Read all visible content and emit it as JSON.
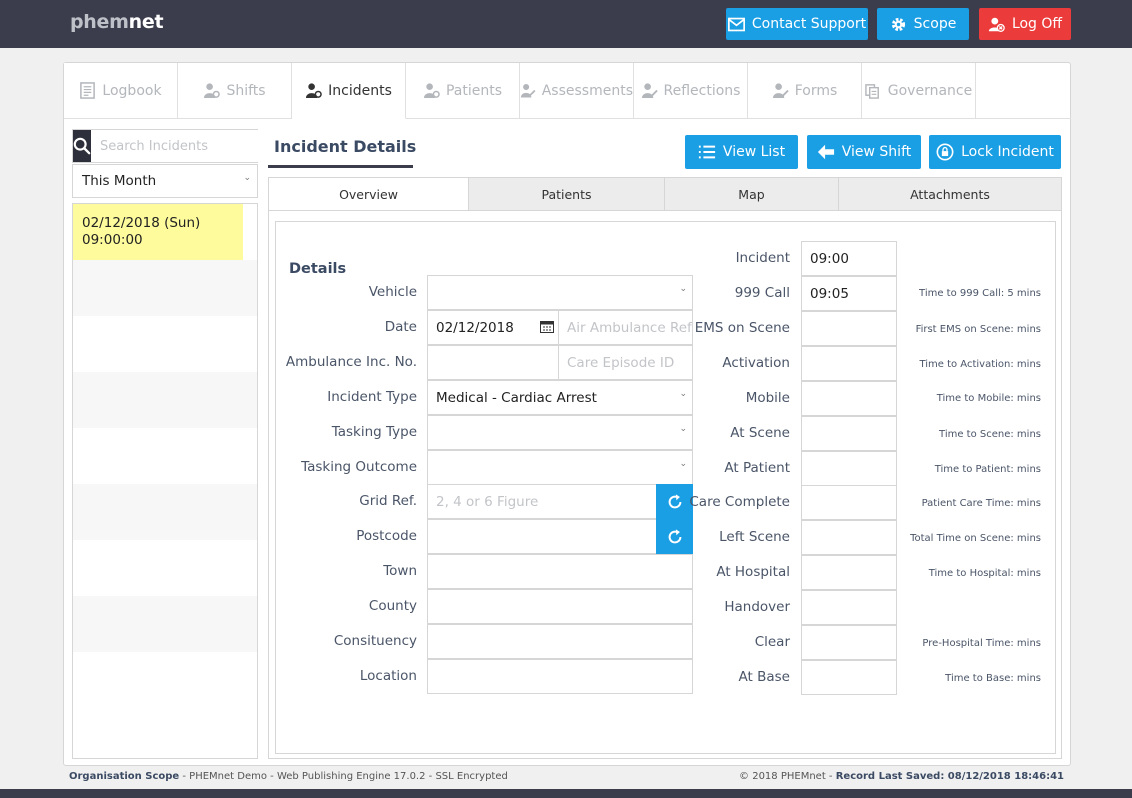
{
  "brand": {
    "prefix": "phem",
    "suffix": "net"
  },
  "topbar": {
    "contact_support": "Contact Support",
    "scope": "Scope",
    "log_off": "Log Off"
  },
  "nav_tabs": [
    {
      "label": "Logbook",
      "icon": "logbook-icon",
      "active": false
    },
    {
      "label": "Shifts",
      "icon": "shifts-icon",
      "active": false
    },
    {
      "label": "Incidents",
      "icon": "incidents-icon",
      "active": true
    },
    {
      "label": "Patients",
      "icon": "patients-icon",
      "active": false
    },
    {
      "label": "Assessments",
      "icon": "assessments-icon",
      "active": false
    },
    {
      "label": "Reflections",
      "icon": "reflections-icon",
      "active": false
    },
    {
      "label": "Forms",
      "icon": "forms-icon",
      "active": false
    },
    {
      "label": "Governance",
      "icon": "governance-icon",
      "active": false
    }
  ],
  "sidebar": {
    "search_placeholder": "Search Incidents",
    "period": "This Month",
    "incidents": [
      {
        "date": "02/12/2018 (Sun)",
        "time": "09:00:00"
      }
    ]
  },
  "details": {
    "title": "Incident Details",
    "view_list": "View List",
    "view_shift": "View Shift",
    "lock_incident": "Lock Incident",
    "subtabs": [
      "Overview",
      "Patients",
      "Map",
      "Attachments"
    ],
    "section_title": "Details",
    "fields": {
      "vehicle_label": "Vehicle",
      "vehicle_value": "",
      "date_label": "Date",
      "date_value": "02/12/2018",
      "air_ambulance_placeholder": "Air Ambulance Ref",
      "ambulance_inc_label": "Ambulance Inc. No.",
      "care_episode_placeholder": "Care Episode ID",
      "incident_type_label": "Incident Type",
      "incident_type_value": "Medical - Cardiac Arrest",
      "tasking_type_label": "Tasking Type",
      "tasking_outcome_label": "Tasking Outcome",
      "grid_ref_label": "Grid Ref.",
      "grid_ref_placeholder": "2, 4 or 6 Figure",
      "postcode_label": "Postcode",
      "town_label": "Town",
      "county_label": "County",
      "constituency_label": "Consituency",
      "location_label": "Location"
    },
    "times": [
      {
        "label": "Incident",
        "value": "09:00",
        "duration": ""
      },
      {
        "label": "999 Call",
        "value": "09:05",
        "duration": "Time to 999 Call: 5 mins"
      },
      {
        "label": "EMS on Scene",
        "value": "",
        "duration": "First EMS on Scene:  mins"
      },
      {
        "label": "Activation",
        "value": "",
        "duration": "Time to Activation:  mins"
      },
      {
        "label": "Mobile",
        "value": "",
        "duration": "Time to Mobile:  mins"
      },
      {
        "label": "At Scene",
        "value": "",
        "duration": "Time to Scene:  mins"
      },
      {
        "label": "At Patient",
        "value": "",
        "duration": "Time to Patient:  mins"
      },
      {
        "label": "Care Complete",
        "value": "",
        "duration": "Patient Care Time:  mins"
      },
      {
        "label": "Left Scene",
        "value": "",
        "duration": "Total Time on Scene:  mins"
      },
      {
        "label": "At Hospital",
        "value": "",
        "duration": "Time to Hospital:  mins"
      },
      {
        "label": "Handover",
        "value": "",
        "duration": ""
      },
      {
        "label": "Clear",
        "value": "",
        "duration": "Pre-Hospital Time:  mins"
      },
      {
        "label": "At Base",
        "value": "",
        "duration": "Time to Base:  mins"
      }
    ]
  },
  "footer": {
    "scope_label": "Organisation Scope",
    "scope_text": " - PHEMnet Demo - Web Publishing Engine 17.0.2 - SSL Encrypted",
    "copyright": "© 2018 PHEMnet - ",
    "saved_label": "Record Last Saved: 08/12/2018 18:46:41"
  },
  "colors": {
    "topbar": "#3b3d4c",
    "accent": "#1a9ee4",
    "danger": "#ec3b3b",
    "selected_row": "#fdfb9c"
  }
}
